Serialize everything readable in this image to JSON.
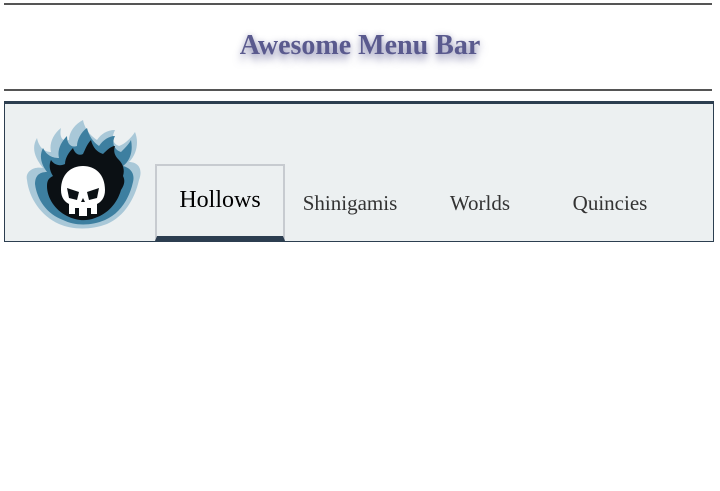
{
  "header": {
    "title": "Awesome Menu Bar"
  },
  "menu": {
    "logo_icon": "flaming-skull-icon",
    "items": [
      {
        "label": "Hollows",
        "active": true
      },
      {
        "label": "Shinigamis",
        "active": false
      },
      {
        "label": "Worlds",
        "active": false
      },
      {
        "label": "Quincies",
        "active": false
      }
    ]
  },
  "colors": {
    "title": "#5a5a8e",
    "menubar_bg": "#ecf0f1",
    "menubar_border": "#2c3e50",
    "active_underline": "#2c3e50",
    "logo_blue": "#3d7fa0",
    "logo_light": "#a9c8d8"
  }
}
